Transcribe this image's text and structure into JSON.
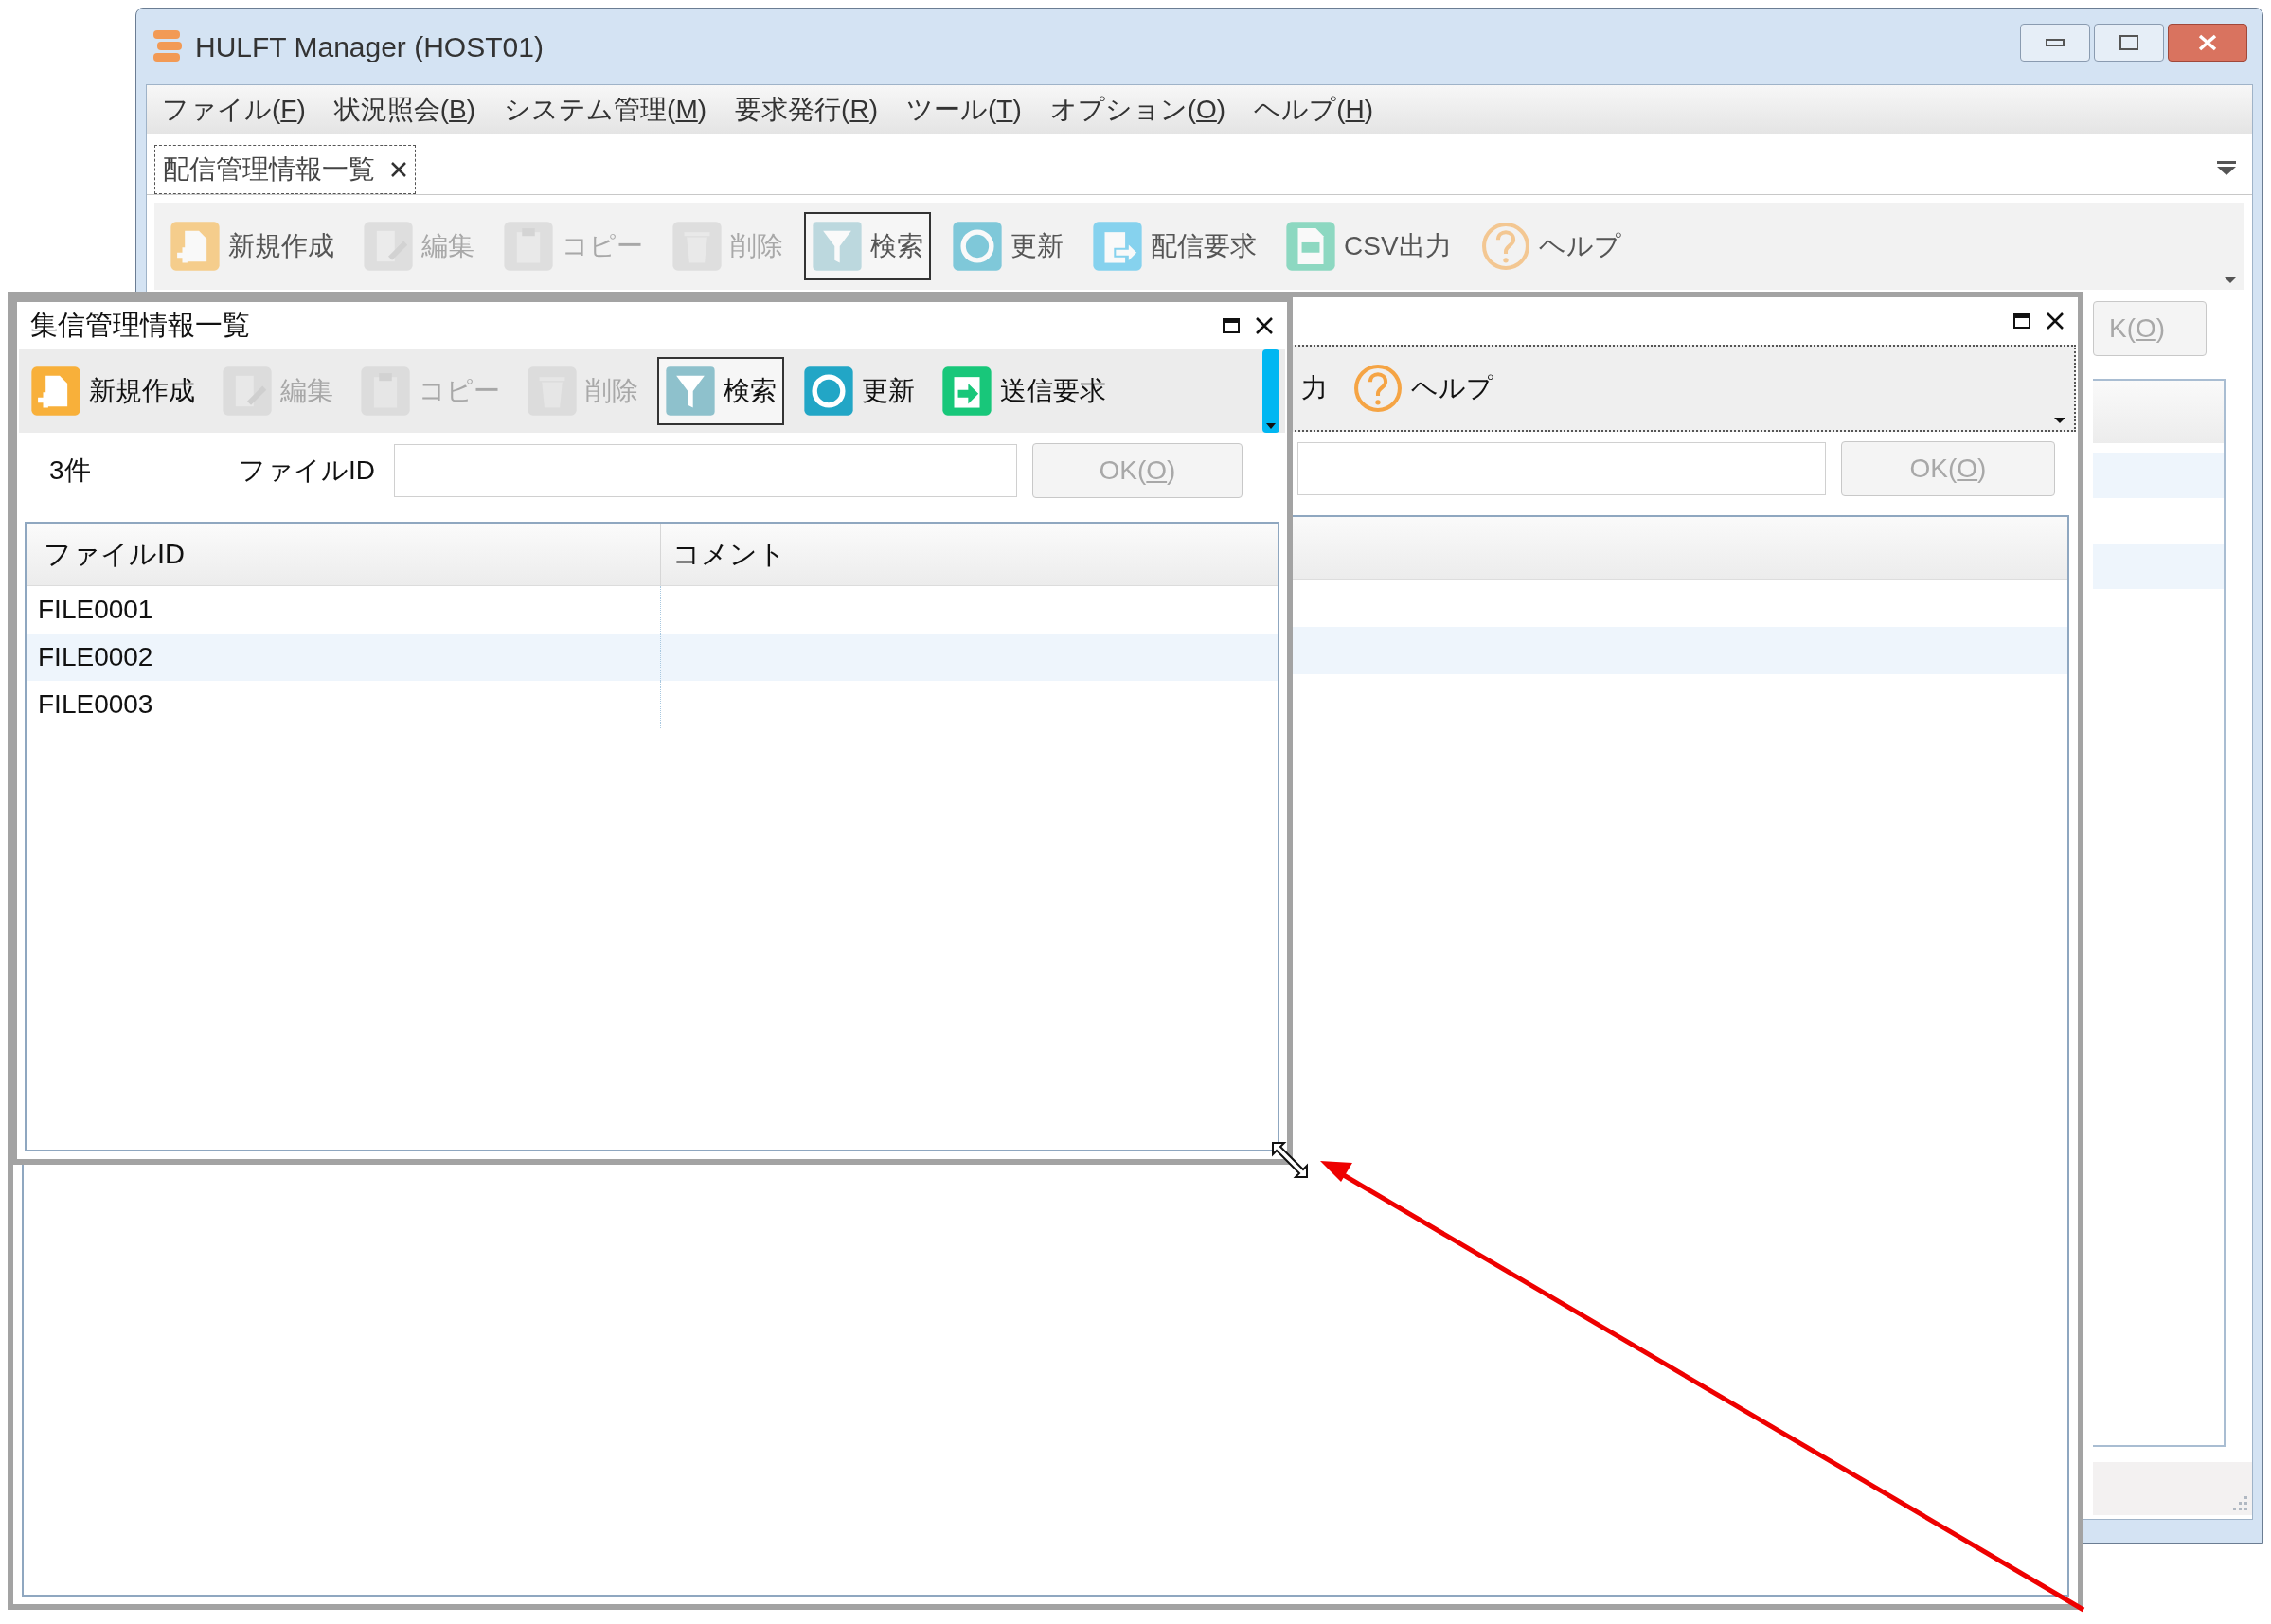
{
  "main_window": {
    "title": "HULFT Manager (HOST01)",
    "menu": [
      {
        "before": "ファイル(",
        "mnemonic": "F",
        "after": ")"
      },
      {
        "before": "状況照会(",
        "mnemonic": "B",
        "after": ")"
      },
      {
        "before": "システム管理(",
        "mnemonic": "M",
        "after": ")"
      },
      {
        "before": "要求発行(",
        "mnemonic": "R",
        "after": ")"
      },
      {
        "before": "ツール(",
        "mnemonic": "T",
        "after": ")"
      },
      {
        "before": "オプション(",
        "mnemonic": "O",
        "after": ")"
      },
      {
        "before": "ヘルプ(",
        "mnemonic": "H",
        "after": ")"
      }
    ],
    "tabs": [
      {
        "label": "配信管理情報一覧",
        "selected": true
      }
    ],
    "toolbar": [
      {
        "kind": "new",
        "label": "新規作成",
        "disabled": false,
        "pressed": false
      },
      {
        "kind": "edit",
        "label": "編集",
        "disabled": true,
        "pressed": false
      },
      {
        "kind": "copy",
        "label": "コピー",
        "disabled": true,
        "pressed": false
      },
      {
        "kind": "delete",
        "label": "削除",
        "disabled": true,
        "pressed": false
      },
      {
        "kind": "filter",
        "label": "検索",
        "disabled": false,
        "pressed": true
      },
      {
        "kind": "refresh",
        "label": "更新",
        "disabled": false,
        "pressed": false
      },
      {
        "kind": "send",
        "label": "配信要求",
        "disabled": false,
        "pressed": false
      },
      {
        "kind": "csv",
        "label": "CSV出力",
        "disabled": false,
        "pressed": false
      },
      {
        "kind": "help",
        "label": "ヘルプ",
        "disabled": false,
        "pressed": false
      }
    ],
    "ok_button": {
      "before": "K(",
      "mnemonic": "O",
      "after": ")",
      "disabled": true
    }
  },
  "resize_outline_window": {
    "toolbar": [
      {
        "kind": "none",
        "label": "力",
        "disabled": false,
        "pressed": false
      },
      {
        "kind": "help",
        "label": "ヘルプ",
        "disabled": false,
        "pressed": false
      }
    ],
    "ok_button": {
      "before": "OK(",
      "mnemonic": "O",
      "after": ")",
      "disabled": true
    }
  },
  "receive_window": {
    "title": "集信管理情報一覧",
    "toolbar": [
      {
        "kind": "new",
        "label": "新規作成",
        "disabled": false,
        "pressed": false
      },
      {
        "kind": "edit",
        "label": "編集",
        "disabled": true,
        "pressed": false
      },
      {
        "kind": "copy",
        "label": "コピー",
        "disabled": true,
        "pressed": false
      },
      {
        "kind": "delete",
        "label": "削除",
        "disabled": true,
        "pressed": false
      },
      {
        "kind": "filter",
        "label": "検索",
        "disabled": false,
        "pressed": true
      },
      {
        "kind": "refresh",
        "label": "更新",
        "disabled": false,
        "pressed": false
      },
      {
        "kind": "receive",
        "label": "送信要求",
        "disabled": false,
        "pressed": false
      }
    ],
    "count": "3件",
    "filter_label": "ファイルID",
    "ok_button": {
      "before": "OK(",
      "mnemonic": "O",
      "after": ")",
      "disabled": true
    },
    "table": {
      "columns": [
        "ファイルID",
        "コメント"
      ],
      "rows": [
        {
          "file_id": "FILE0001"
        },
        {
          "file_id": "FILE0002"
        },
        {
          "file_id": "FILE0003"
        }
      ]
    }
  }
}
